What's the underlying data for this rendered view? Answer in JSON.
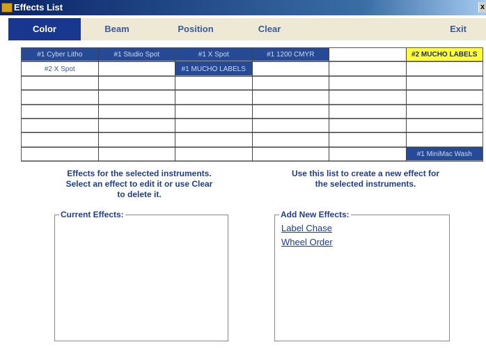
{
  "window": {
    "title": "Effects List",
    "close_label": "x"
  },
  "menu": {
    "tabs": [
      {
        "label": "Color"
      },
      {
        "label": "Beam"
      },
      {
        "label": "Position"
      },
      {
        "label": "Clear"
      },
      {
        "label": "Exit"
      }
    ]
  },
  "grid": {
    "r0": [
      "#1 Cyber Litho",
      "#1 Studio Spot",
      "#1 X Spot",
      "#1 1200 CMYR",
      "",
      "#2 MUCHO LABELS"
    ],
    "r1": [
      "#2 X Spot",
      "",
      "#1 MUCHO LABELS",
      "",
      "",
      ""
    ],
    "r7": [
      "",
      "",
      "",
      "",
      "",
      "#1 MiniMac Wash"
    ]
  },
  "left_info": {
    "line1": "Effects for the selected instruments.",
    "line2": "Select an effect to edit it or use Clear",
    "line3": "to delete it."
  },
  "right_info": {
    "line1": "Use this list to create a new effect for",
    "line2": "the selected instruments."
  },
  "current_effects": {
    "label": "Current Effects:"
  },
  "add_effects": {
    "label": "Add New Effects:",
    "items": [
      "Label Chase",
      "Wheel Order"
    ]
  },
  "colors": {
    "accent": "#19378f",
    "cell_blue": "#264a96",
    "highlight": "#ffff33"
  }
}
